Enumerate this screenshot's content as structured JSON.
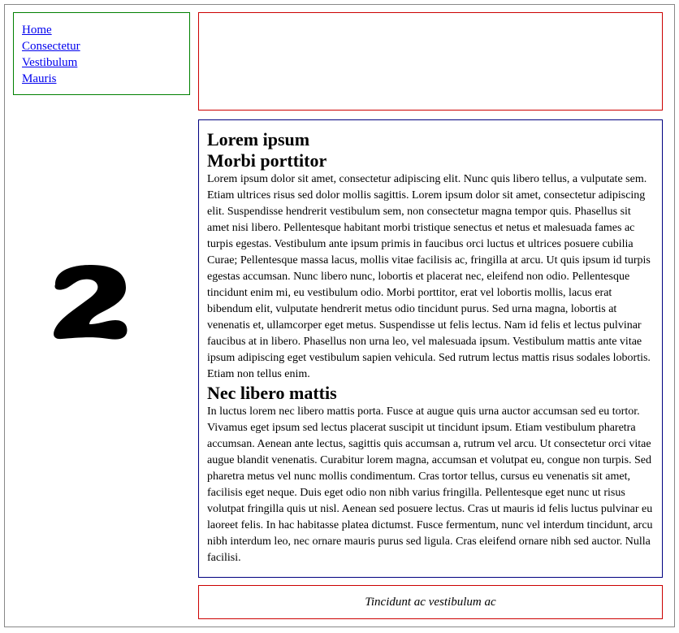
{
  "nav": {
    "links": [
      "Home",
      "Consectetur",
      "Vestibulum",
      "Mauris"
    ]
  },
  "side_glyph": {
    "text": "2",
    "icon": "stylized-number-two"
  },
  "content": {
    "heading1": "Lorem ipsum",
    "heading2": "Morbi porttitor",
    "paragraph1": "Lorem ipsum dolor sit amet, consectetur adipiscing elit. Nunc quis libero tellus, a vulputate sem. Etiam ultrices risus sed dolor mollis sagittis. Lorem ipsum dolor sit amet, consectetur adipiscing elit. Suspendisse hendrerit vestibulum sem, non consectetur magna tempor quis. Phasellus sit amet nisi libero. Pellentesque habitant morbi tristique senectus et netus et malesuada fames ac turpis egestas. Vestibulum ante ipsum primis in faucibus orci luctus et ultrices posuere cubilia Curae; Pellentesque massa lacus, mollis vitae facilisis ac, fringilla at arcu. Ut quis ipsum id turpis egestas accumsan. Nunc libero nunc, lobortis et placerat nec, eleifend non odio. Pellentesque tincidunt enim mi, eu vestibulum odio. Morbi porttitor, erat vel lobortis mollis, lacus erat bibendum elit, vulputate hendrerit metus odio tincidunt purus. Sed urna magna, lobortis at venenatis et, ullamcorper eget metus. Suspendisse ut felis lectus. Nam id felis et lectus pulvinar faucibus at in libero. Phasellus non urna leo, vel malesuada ipsum. Vestibulum mattis ante vitae ipsum adipiscing eget vestibulum sapien vehicula. Sed rutrum lectus mattis risus sodales lobortis. Etiam non tellus enim.",
    "heading3": "Nec libero mattis",
    "paragraph2": "In luctus lorem nec libero mattis porta. Fusce at augue quis urna auctor accumsan sed eu tortor. Vivamus eget ipsum sed lectus placerat suscipit ut tincidunt ipsum. Etiam vestibulum pharetra accumsan. Aenean ante lectus, sagittis quis accumsan a, rutrum vel arcu. Ut consectetur orci vitae augue blandit venenatis. Curabitur lorem magna, accumsan et volutpat eu, congue non turpis. Sed pharetra metus vel nunc mollis condimentum. Cras tortor tellus, cursus eu venenatis sit amet, facilisis eget neque. Duis eget odio non nibh varius fringilla. Pellentesque eget nunc ut risus volutpat fringilla quis ut nisl. Aenean sed posuere lectus. Cras ut mauris id felis luctus pulvinar eu laoreet felis. In hac habitasse platea dictumst. Fusce fermentum, nunc vel interdum tincidunt, arcu nibh interdum leo, nec ornare mauris purus sed ligula. Cras eleifend ornare nibh sed auctor. Nulla facilisi."
  },
  "footer": {
    "text": "Tincidunt ac vestibulum ac"
  },
  "colors": {
    "nav_border": "#008000",
    "header_border": "#cc0000",
    "content_border": "#000080",
    "footer_border": "#cc0000",
    "link": "#0000ee"
  }
}
